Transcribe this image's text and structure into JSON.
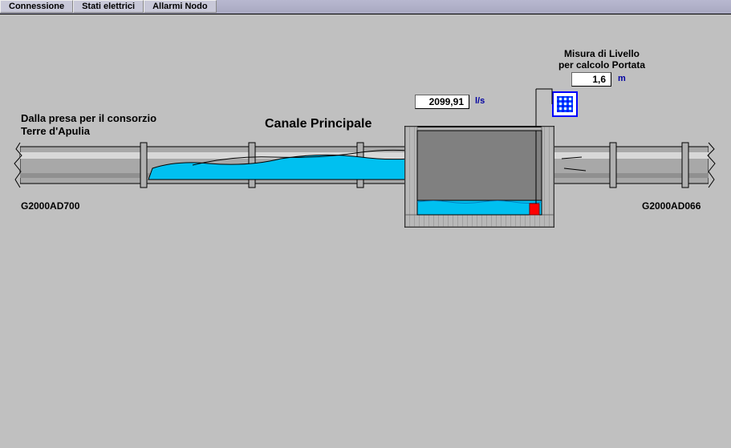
{
  "menu": {
    "connessione": "Connessione",
    "stati": "Stati elettrici",
    "allarmi": "Allarmi Nodo"
  },
  "level": {
    "title1": "Misura di Livello",
    "title2": "per calcolo Portata",
    "value": "1,6",
    "unit": "m"
  },
  "flow": {
    "value": "2099,91",
    "unit": "l/s"
  },
  "labels": {
    "source1": "Dalla presa per il consorzio",
    "source2": "Terre d'Apulia",
    "canal": "Canale Principale",
    "leftCode": "G2000AD700",
    "rightCode": "G2000AD066"
  }
}
